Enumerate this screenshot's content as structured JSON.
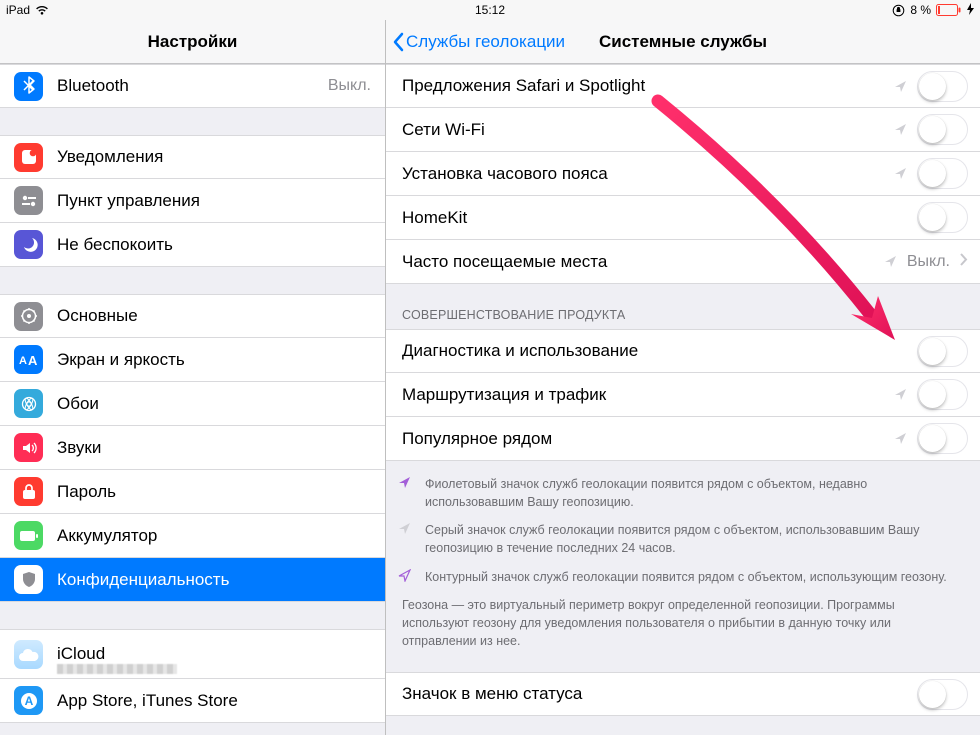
{
  "status": {
    "device": "iPad",
    "time": "15:12",
    "battery_pct": "8 %"
  },
  "sidebar": {
    "title": "Настройки",
    "groups": [
      [
        {
          "label": "Bluetooth",
          "value": "Выкл.",
          "icon": "bluetooth",
          "color": "#007aff"
        }
      ],
      [
        {
          "label": "Уведомления",
          "icon": "notifications",
          "color": "#ff3b30"
        },
        {
          "label": "Пункт управления",
          "icon": "control-center",
          "color": "#8e8e93"
        },
        {
          "label": "Не беспокоить",
          "icon": "dnd",
          "color": "#5856d6"
        }
      ],
      [
        {
          "label": "Основные",
          "icon": "general",
          "color": "#8e8e93"
        },
        {
          "label": "Экран и яркость",
          "icon": "display",
          "color": "#007aff"
        },
        {
          "label": "Обои",
          "icon": "wallpaper",
          "color": "#34aadc"
        },
        {
          "label": "Звуки",
          "icon": "sounds",
          "color": "#ff2d55"
        },
        {
          "label": "Пароль",
          "icon": "passcode",
          "color": "#ff3b30"
        },
        {
          "label": "Аккумулятор",
          "icon": "battery",
          "color": "#4cd964"
        },
        {
          "label": "Конфиденциальность",
          "icon": "privacy",
          "color": "#8e8e93",
          "selected": true
        }
      ],
      [
        {
          "label": "iCloud",
          "icon": "icloud",
          "subtext": ""
        },
        {
          "label": "App Store, iTunes Store",
          "icon": "appstore",
          "color": "#1e98f5"
        }
      ]
    ]
  },
  "detail": {
    "back_label": "Службы геолокации",
    "title": "Системные службы",
    "section1": [
      {
        "label": "Предложения Safari и Spotlight",
        "loc": "gray",
        "switch": false
      },
      {
        "label": "Сети Wi-Fi",
        "loc": "gray",
        "switch": false
      },
      {
        "label": "Установка часового пояса",
        "loc": "gray",
        "switch": false
      },
      {
        "label": "HomeKit",
        "switch": false
      },
      {
        "label": "Часто посещаемые места",
        "loc": "gray",
        "value": "Выкл.",
        "disclosure": true
      }
    ],
    "section2_header": "СОВЕРШЕНСТВОВАНИЕ ПРОДУКТА",
    "section2": [
      {
        "label": "Диагностика и использование",
        "switch": false
      },
      {
        "label": "Маршрутизация и трафик",
        "loc": "gray",
        "switch": false
      },
      {
        "label": "Популярное рядом",
        "loc": "gray",
        "switch": false
      }
    ],
    "footer": {
      "b1": "Фиолетовый значок служб геолокации появится рядом с объектом, недавно использовавшим Вашу геопозицию.",
      "b2": "Серый значок служб геолокации появится рядом с объектом, использовавшим Вашу геопозицию в течение последних 24 часов.",
      "b3": "Контурный значок служб геолокации появится рядом с объектом, использующим геозону.",
      "p1": "Геозона — это виртуальный периметр вокруг определенной геопозиции. Программы используют геозону для уведомления пользователя о прибытии в данную точку или отправлении из нее."
    },
    "section3": [
      {
        "label": "Значок в меню статуса",
        "switch": false
      }
    ]
  }
}
